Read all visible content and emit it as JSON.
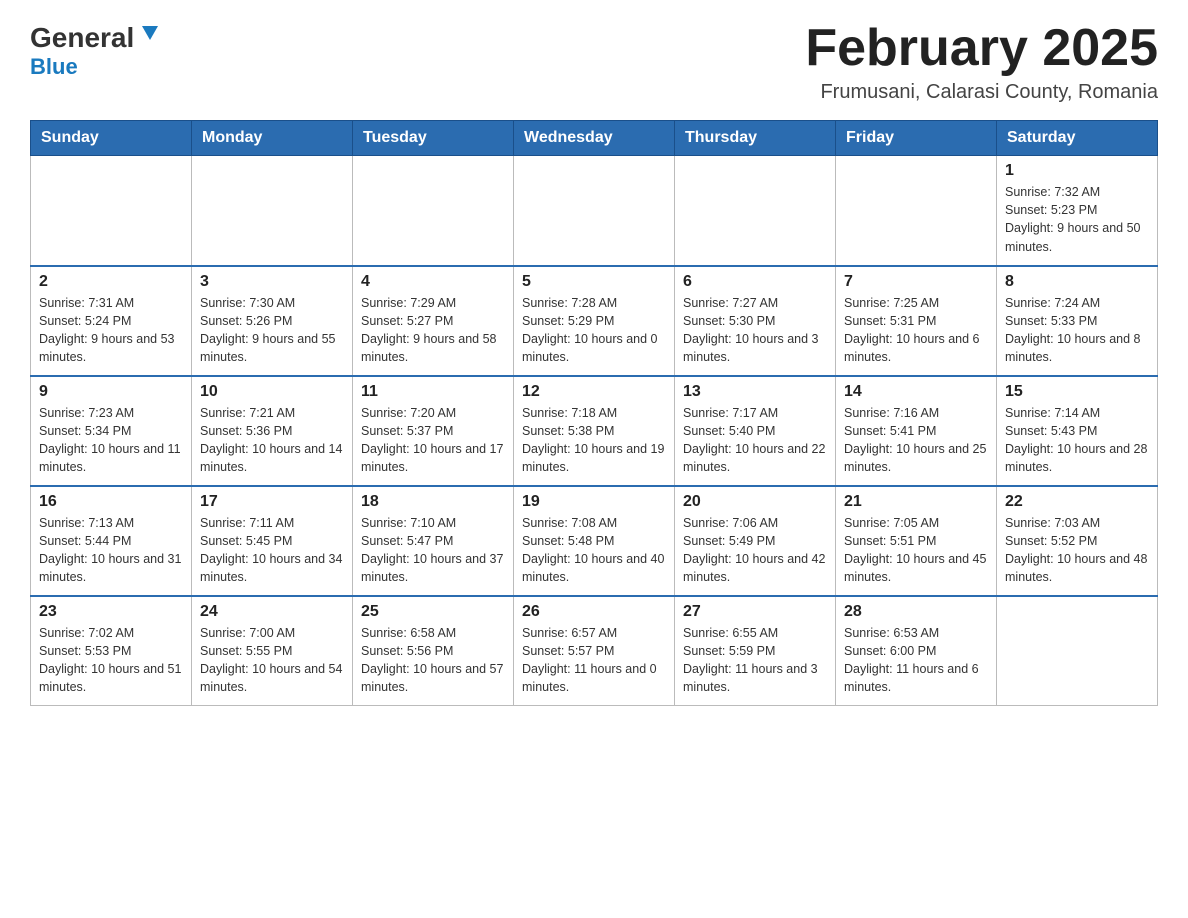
{
  "header": {
    "logo_main": "General",
    "logo_sub": "Blue",
    "month_title": "February 2025",
    "subtitle": "Frumusani, Calarasi County, Romania"
  },
  "days_of_week": [
    "Sunday",
    "Monday",
    "Tuesday",
    "Wednesday",
    "Thursday",
    "Friday",
    "Saturday"
  ],
  "weeks": [
    {
      "days": [
        {
          "num": "",
          "info": ""
        },
        {
          "num": "",
          "info": ""
        },
        {
          "num": "",
          "info": ""
        },
        {
          "num": "",
          "info": ""
        },
        {
          "num": "",
          "info": ""
        },
        {
          "num": "",
          "info": ""
        },
        {
          "num": "1",
          "info": "Sunrise: 7:32 AM\nSunset: 5:23 PM\nDaylight: 9 hours and 50 minutes."
        }
      ]
    },
    {
      "days": [
        {
          "num": "2",
          "info": "Sunrise: 7:31 AM\nSunset: 5:24 PM\nDaylight: 9 hours and 53 minutes."
        },
        {
          "num": "3",
          "info": "Sunrise: 7:30 AM\nSunset: 5:26 PM\nDaylight: 9 hours and 55 minutes."
        },
        {
          "num": "4",
          "info": "Sunrise: 7:29 AM\nSunset: 5:27 PM\nDaylight: 9 hours and 58 minutes."
        },
        {
          "num": "5",
          "info": "Sunrise: 7:28 AM\nSunset: 5:29 PM\nDaylight: 10 hours and 0 minutes."
        },
        {
          "num": "6",
          "info": "Sunrise: 7:27 AM\nSunset: 5:30 PM\nDaylight: 10 hours and 3 minutes."
        },
        {
          "num": "7",
          "info": "Sunrise: 7:25 AM\nSunset: 5:31 PM\nDaylight: 10 hours and 6 minutes."
        },
        {
          "num": "8",
          "info": "Sunrise: 7:24 AM\nSunset: 5:33 PM\nDaylight: 10 hours and 8 minutes."
        }
      ]
    },
    {
      "days": [
        {
          "num": "9",
          "info": "Sunrise: 7:23 AM\nSunset: 5:34 PM\nDaylight: 10 hours and 11 minutes."
        },
        {
          "num": "10",
          "info": "Sunrise: 7:21 AM\nSunset: 5:36 PM\nDaylight: 10 hours and 14 minutes."
        },
        {
          "num": "11",
          "info": "Sunrise: 7:20 AM\nSunset: 5:37 PM\nDaylight: 10 hours and 17 minutes."
        },
        {
          "num": "12",
          "info": "Sunrise: 7:18 AM\nSunset: 5:38 PM\nDaylight: 10 hours and 19 minutes."
        },
        {
          "num": "13",
          "info": "Sunrise: 7:17 AM\nSunset: 5:40 PM\nDaylight: 10 hours and 22 minutes."
        },
        {
          "num": "14",
          "info": "Sunrise: 7:16 AM\nSunset: 5:41 PM\nDaylight: 10 hours and 25 minutes."
        },
        {
          "num": "15",
          "info": "Sunrise: 7:14 AM\nSunset: 5:43 PM\nDaylight: 10 hours and 28 minutes."
        }
      ]
    },
    {
      "days": [
        {
          "num": "16",
          "info": "Sunrise: 7:13 AM\nSunset: 5:44 PM\nDaylight: 10 hours and 31 minutes."
        },
        {
          "num": "17",
          "info": "Sunrise: 7:11 AM\nSunset: 5:45 PM\nDaylight: 10 hours and 34 minutes."
        },
        {
          "num": "18",
          "info": "Sunrise: 7:10 AM\nSunset: 5:47 PM\nDaylight: 10 hours and 37 minutes."
        },
        {
          "num": "19",
          "info": "Sunrise: 7:08 AM\nSunset: 5:48 PM\nDaylight: 10 hours and 40 minutes."
        },
        {
          "num": "20",
          "info": "Sunrise: 7:06 AM\nSunset: 5:49 PM\nDaylight: 10 hours and 42 minutes."
        },
        {
          "num": "21",
          "info": "Sunrise: 7:05 AM\nSunset: 5:51 PM\nDaylight: 10 hours and 45 minutes."
        },
        {
          "num": "22",
          "info": "Sunrise: 7:03 AM\nSunset: 5:52 PM\nDaylight: 10 hours and 48 minutes."
        }
      ]
    },
    {
      "days": [
        {
          "num": "23",
          "info": "Sunrise: 7:02 AM\nSunset: 5:53 PM\nDaylight: 10 hours and 51 minutes."
        },
        {
          "num": "24",
          "info": "Sunrise: 7:00 AM\nSunset: 5:55 PM\nDaylight: 10 hours and 54 minutes."
        },
        {
          "num": "25",
          "info": "Sunrise: 6:58 AM\nSunset: 5:56 PM\nDaylight: 10 hours and 57 minutes."
        },
        {
          "num": "26",
          "info": "Sunrise: 6:57 AM\nSunset: 5:57 PM\nDaylight: 11 hours and 0 minutes."
        },
        {
          "num": "27",
          "info": "Sunrise: 6:55 AM\nSunset: 5:59 PM\nDaylight: 11 hours and 3 minutes."
        },
        {
          "num": "28",
          "info": "Sunrise: 6:53 AM\nSunset: 6:00 PM\nDaylight: 11 hours and 6 minutes."
        },
        {
          "num": "",
          "info": ""
        }
      ]
    }
  ]
}
